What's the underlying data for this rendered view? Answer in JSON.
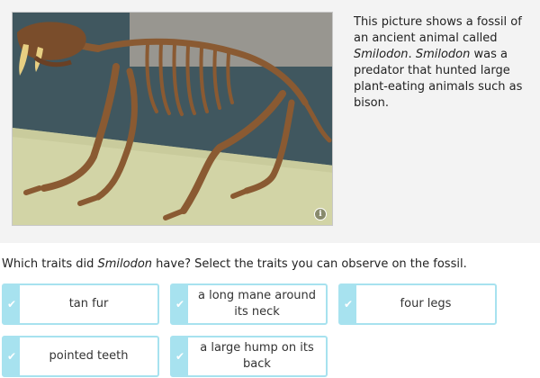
{
  "caption": {
    "part1": "This picture shows a fossil of an ancient animal called ",
    "name1": "Smilodon",
    "part2": ". ",
    "name2": "Smilodon",
    "part3": " was a predator that hunted large plant-eating animals such as bison."
  },
  "photo": {
    "info_icon_glyph": "i"
  },
  "question": {
    "part1": "Which traits did ",
    "name": "Smilodon",
    "part2": " have? Select the traits you can observe on the fossil."
  },
  "options": [
    {
      "label": "tan fur",
      "selected": false
    },
    {
      "label": "a long mane around its neck",
      "selected": false
    },
    {
      "label": "four legs",
      "selected": false
    },
    {
      "label": "pointed teeth",
      "selected": false
    },
    {
      "label": "a large hump on its back",
      "selected": false
    }
  ],
  "colors": {
    "tile_border": "#a7e2ef",
    "panel_bg": "#f3f3f3"
  }
}
